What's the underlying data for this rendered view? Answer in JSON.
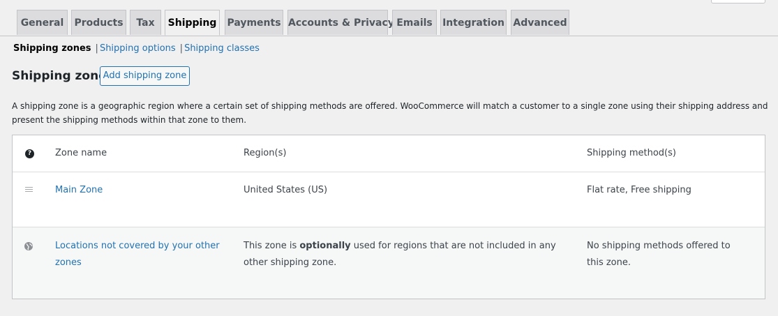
{
  "tabs": [
    {
      "label": "General"
    },
    {
      "label": "Products"
    },
    {
      "label": "Tax"
    },
    {
      "label": "Shipping"
    },
    {
      "label": "Payments"
    },
    {
      "label": "Accounts & Privacy"
    },
    {
      "label": "Emails"
    },
    {
      "label": "Integration"
    },
    {
      "label": "Advanced"
    }
  ],
  "active_tab": "Shipping",
  "subnav": {
    "current": "Shipping zones",
    "separator": "|",
    "options": "Shipping options",
    "classes": "Shipping classes"
  },
  "heading": {
    "title": "Shipping zones",
    "add_button": "Add shipping zone"
  },
  "description": "A shipping zone is a geographic region where a certain set of shipping methods are offered. WooCommerce will match a customer to a single zone using their shipping address and present the shipping methods within that zone to them.",
  "table": {
    "headers": {
      "help": "?",
      "zone_name": "Zone name",
      "regions": "Region(s)",
      "methods": "Shipping method(s)"
    },
    "rows": [
      {
        "zone_name": "Main Zone",
        "regions": "United States (US)",
        "methods": "Flat rate, Free shipping"
      }
    ],
    "rest_of_world": {
      "zone_name": "Locations not covered by your other zones",
      "regions_before": "This zone is ",
      "regions_emphasis": "optionally",
      "regions_after": " used for regions that are not included in any other shipping zone.",
      "methods": "No shipping methods offered to this zone."
    }
  },
  "colors": {
    "background": "#f0f0f1",
    "link": "#2271b1",
    "tab_inactive": "#dcdcde",
    "border": "#c3c4c7"
  },
  "icons": [
    "help-icon",
    "drag-handle-icon",
    "globe-icon"
  ]
}
